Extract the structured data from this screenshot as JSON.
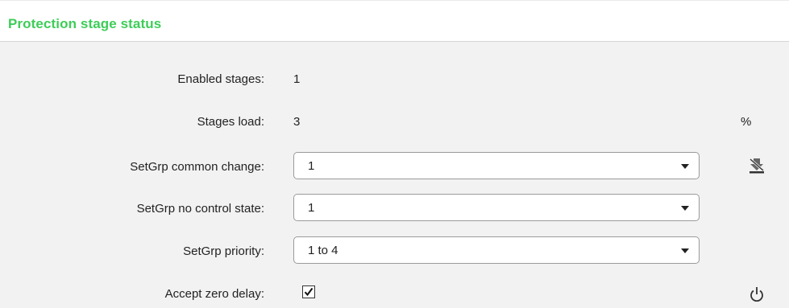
{
  "header": {
    "title": "Protection stage status"
  },
  "fields": {
    "enabled_stages": {
      "label": "Enabled stages:",
      "value": "1"
    },
    "stages_load": {
      "label": "Stages load:",
      "value": "3",
      "unit": "%"
    },
    "setgrp_common_change": {
      "label": "SetGrp common change:",
      "selected": "1"
    },
    "setgrp_no_control_state": {
      "label": "SetGrp no control state:",
      "selected": "1"
    },
    "setgrp_priority": {
      "label": "SetGrp priority:",
      "selected": "1 to 4"
    },
    "accept_zero_delay": {
      "label": "Accept zero delay:",
      "checked": true
    }
  },
  "icons": {
    "write_setting": "download-disabled-icon",
    "restart": "power-icon"
  },
  "colors": {
    "accent": "#3dcd58"
  }
}
